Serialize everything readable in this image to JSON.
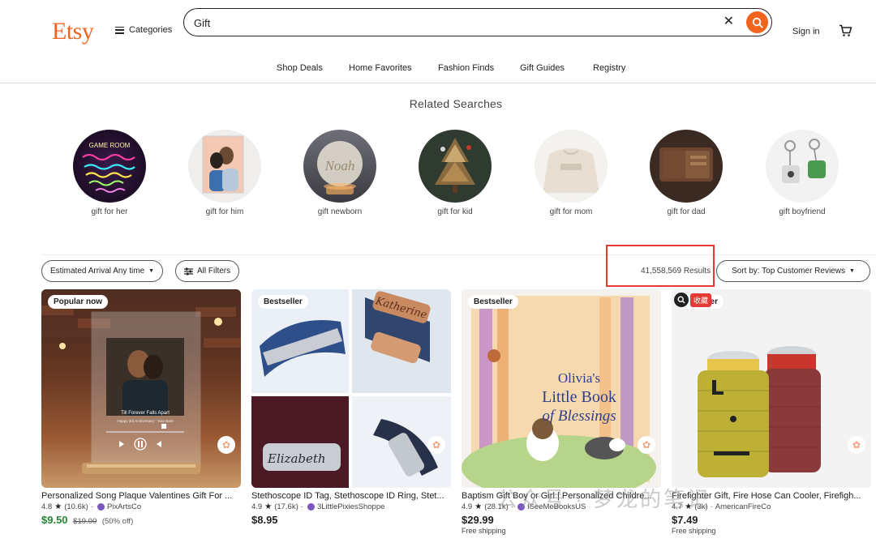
{
  "header": {
    "logo": "Etsy",
    "categories_label": "Categories",
    "search_value": "Gift",
    "sign_in": "Sign in"
  },
  "nav": [
    "Shop Deals",
    "Home Favorites",
    "Fashion Finds",
    "Gift Guides",
    "Registry"
  ],
  "related": {
    "title": "Related Searches",
    "items": [
      {
        "label": "gift for her",
        "photo_text": "GAME ROOM"
      },
      {
        "label": "gift for him"
      },
      {
        "label": "gift newborn",
        "photo_text": "Noah"
      },
      {
        "label": "gift for kid"
      },
      {
        "label": "gift for mom"
      },
      {
        "label": "gift for dad"
      },
      {
        "label": "gift boyfriend"
      }
    ]
  },
  "filters": {
    "arrival": "Estimated Arrival Any time",
    "all_filters": "All Filters",
    "results": "41,558,569 Results",
    "sort": "Sort by: Top Customer Reviews"
  },
  "listings": [
    {
      "badge": "Popular now",
      "title": "Personalized Song Plaque Valentines Gift For ...",
      "rating": "4.8",
      "reviews": "(10.6k)",
      "shop": "PixArtsCo",
      "price": "$9.50",
      "original_price": "$19.00",
      "discount": "(50% off)",
      "shipping": "",
      "image_text": {
        "song": "Till Forever Falls Apart",
        "subtitle": "Happy 3rd Anniversary - Your Bae!"
      }
    },
    {
      "badge": "Bestseller",
      "title": "Stethoscope ID Tag, Stethoscope ID Ring, Stet...",
      "rating": "4.9",
      "reviews": "(17.6k)",
      "shop": "3LittlePixiesShoppe",
      "price": "$8.95",
      "shipping": "",
      "image_text": {
        "name1": "Katherine",
        "name2": "Elizabeth"
      }
    },
    {
      "badge": "Bestseller",
      "title": "Baptism Gift Boy or Girl | Personalized Childre...",
      "rating": "4.9",
      "reviews": "(28.1k)",
      "shop": "ISeeMeBooksUS",
      "price": "$29.99",
      "shipping": "Free shipping",
      "image_text": {
        "line1": "Olivia's",
        "line2": "Little Book",
        "line3": "of Blessings"
      }
    },
    {
      "badge": "ller",
      "title": "Firefighter Gift, Fire Hose Can Cooler, Firefigh...",
      "rating": "4.7",
      "reviews": "(3k)",
      "shop": "AmericanFireCo",
      "price": "$7.49",
      "shipping": "Free shipping",
      "collect_label": "收藏"
    }
  ],
  "watermark": "公众号 · 梦龙的笔记",
  "colors": {
    "brand": "#f1641e",
    "sale": "#258635",
    "highlight": "#e53935"
  }
}
